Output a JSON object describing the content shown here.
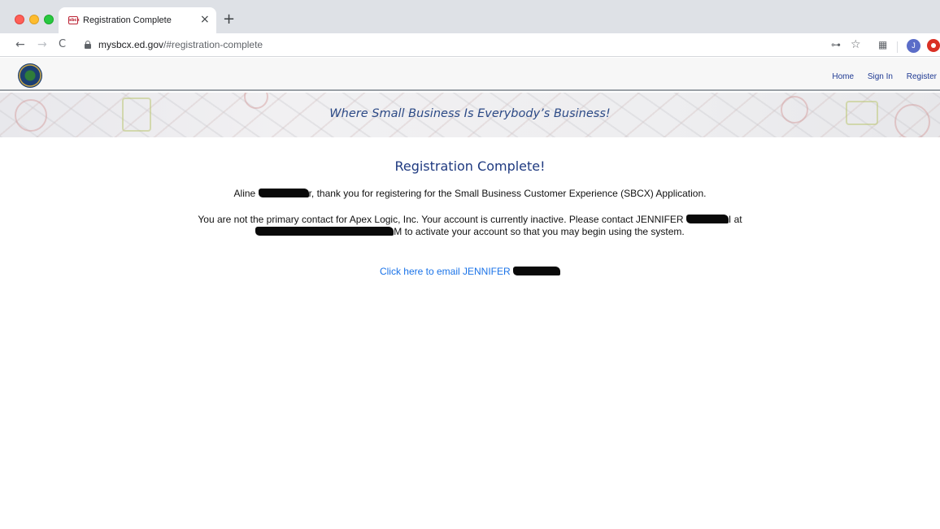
{
  "browser": {
    "tab_title": "Registration Complete",
    "tab_favicon_text": "sbcx",
    "tab_close": "×",
    "new_tab": "+",
    "url_host": "mysbcx.ed.gov",
    "url_path": "/#registration-complete",
    "avatar_initial": "J",
    "icons": {
      "back": "←",
      "forward": "→",
      "reload": "C",
      "key": "⊶",
      "star": "☆",
      "qr": "▦"
    }
  },
  "site": {
    "nav": {
      "home": "Home",
      "sign_in": "Sign In",
      "register": "Register"
    },
    "banner_text": "Where Small Business Is Everybody’s Business!"
  },
  "main": {
    "title": "Registration Complete!",
    "thanks_prefix": "Aline ",
    "thanks_visible_tail": "r",
    "thanks_suffix": ", thank you for registering for the Small Business Customer Experience (SBCX) Application.",
    "inactive_line1_prefix": "You are not the primary contact for Apex Logic, Inc. Your account is currently inactive. Please contact JENNIFER ",
    "inactive_line1_tail": "I at",
    "inactive_line2_tail": "M",
    "inactive_line2_suffix": " to activate your account so that you may begin using the system.",
    "email_link_prefix": "Click here to email JENNIFER "
  },
  "colors": {
    "title_blue": "#1f3a80",
    "link_blue": "#1a73e8",
    "nav_blue": "#1f3a93"
  }
}
